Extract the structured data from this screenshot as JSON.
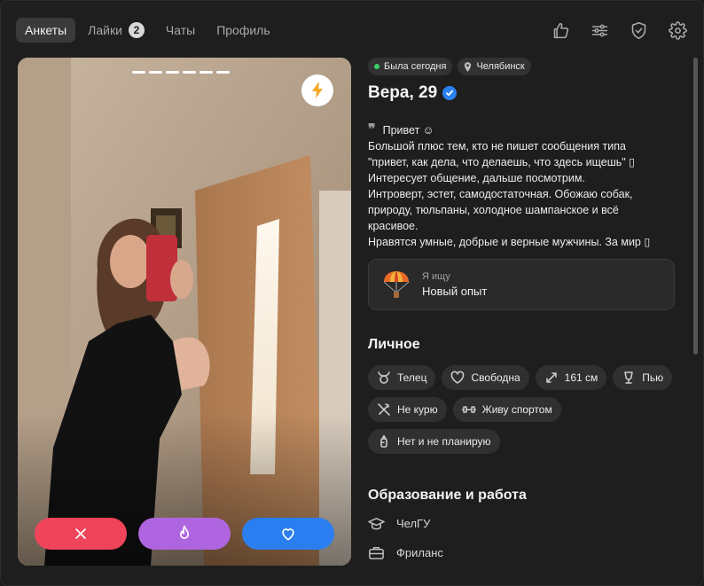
{
  "nav": {
    "tabs": [
      {
        "label": "Анкеты",
        "active": true
      },
      {
        "label": "Лайки",
        "badge": "2"
      },
      {
        "label": "Чаты"
      },
      {
        "label": "Профиль"
      }
    ],
    "tool_icons": [
      "thumbs-up-icon",
      "filters-icon",
      "shield-check-icon",
      "gear-icon"
    ]
  },
  "photo": {
    "photo_count": 6,
    "boost_icon": "lightning-icon",
    "actions": [
      "dislike-x-icon",
      "flame-icon",
      "heart-icon"
    ]
  },
  "profile": {
    "status": "Была сегодня",
    "city": "Челябинск",
    "name": "Вера, 29",
    "bio_greeting": "Привет ☺",
    "bio": "Большой плюс тем, кто не пишет сообщения типа\n\"привет, как дела, что делаешь, что здесь ищешь\" ▯\nИнтересует общение, дальше посмотрим.\nИнтроверт, эстет, самодостаточная. Обожаю собак,\nприроду, тюльпаны, холодное шампанское и всё\nкрасивое.\nНравятся умные, добрые и верные мужчины. За мир ▯",
    "seeking_label": "Я ищу",
    "seeking_value": "Новый опыт"
  },
  "personal": {
    "title": "Личное",
    "tags": [
      {
        "icon": "taurus-icon",
        "label": "Телец"
      },
      {
        "icon": "heart-outline-icon",
        "label": "Свободна"
      },
      {
        "icon": "height-icon",
        "label": "161 см"
      },
      {
        "icon": "wine-glass-icon",
        "label": "Пью"
      },
      {
        "icon": "no-smoking-icon",
        "label": "Не курю"
      },
      {
        "icon": "dumbbell-icon",
        "label": "Живу спортом"
      },
      {
        "icon": "baby-bottle-icon",
        "label": "Нет и не планирую"
      }
    ]
  },
  "education": {
    "title": "Образование и работа",
    "items": [
      {
        "icon": "graduation-cap-icon",
        "label": "ЧелГУ"
      },
      {
        "icon": "briefcase-icon",
        "label": "Фриланс"
      }
    ]
  },
  "colors": {
    "background": "#1e1e1e",
    "dislike": "#f0445a",
    "superlike": "#b065e0",
    "like": "#2b7ef0",
    "online": "#3ccf6a",
    "verified": "#2b80f0",
    "boost": "#f5a623"
  }
}
